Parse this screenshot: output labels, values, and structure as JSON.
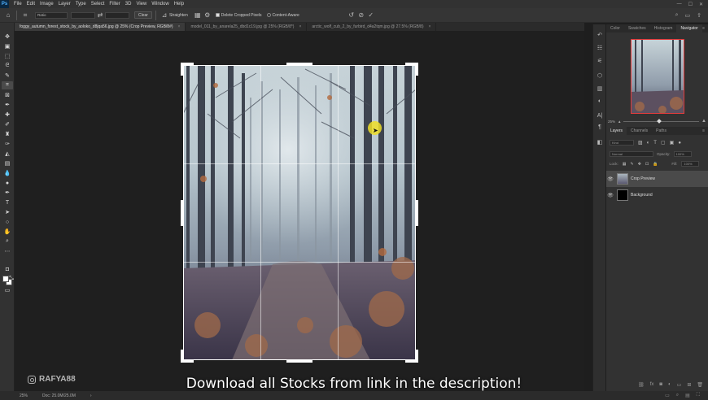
{
  "app": {
    "logo": "Ps"
  },
  "menu": [
    "File",
    "Edit",
    "Image",
    "Layer",
    "Type",
    "Select",
    "Filter",
    "3D",
    "View",
    "Window",
    "Help"
  ],
  "window_controls": [
    "—",
    "☐",
    "✕"
  ],
  "options_bar": {
    "ratio_label": "Ratio",
    "clear_label": "Clear",
    "straighten_label": "Straighten",
    "delete_cropped_label": "Delete Cropped Pixels",
    "content_aware_label": "Content-Aware"
  },
  "tabs": [
    {
      "label": "foggy_autumn_forest_stock_by_aoloko_d8jqa56.jpg @ 25% (Crop Preview, RGB/8#)",
      "active": true
    },
    {
      "label": "model_011_by_anarela25_dbd1c19.jpg @ 25% (RGB/8*)",
      "active": false
    },
    {
      "label": "arctic_wolf_cub_2_by_furbird_d4a2tqm.jpg @ 27.5% (RGB/8)",
      "active": false
    }
  ],
  "tools": [
    "move-tool-icon",
    "artboard-icon",
    "marquee-tool-icon",
    "lasso-tool-icon",
    "quick-select-icon",
    "crop-tool-icon",
    "frame-tool-icon",
    "eyedropper-icon",
    "healing-brush-icon",
    "brush-tool-icon",
    "clone-stamp-icon",
    "history-brush-icon",
    "eraser-icon",
    "gradient-tool-icon",
    "blur-tool-icon",
    "dodge-tool-icon",
    "pen-tool-icon",
    "type-tool-icon",
    "path-select-icon",
    "rectangle-tool-icon",
    "hand-tool-icon",
    "zoom-tool-icon",
    "more-tools-icon"
  ],
  "caption": "Download all Stocks from link in the description!",
  "watermark": "RAFYA88",
  "status": {
    "zoom": "25%",
    "doc": "Doc: 25.0M/25.0M"
  },
  "right_panel": {
    "top_tabs": [
      "Color",
      "Swatches",
      "Histogram",
      "Navigator"
    ],
    "zoom_value": "25%",
    "layer_tabs": [
      "Layers",
      "Channels",
      "Paths"
    ],
    "kind_label": "Kind",
    "blend_mode": "Normal",
    "opacity_label": "Opacity:",
    "opacity_value": "100%",
    "lock_label": "Lock:",
    "fill_label": "Fill:",
    "fill_value": "100%",
    "layers": [
      {
        "name": "Crop Preview",
        "selected": true
      },
      {
        "name": "Background",
        "selected": false
      }
    ]
  },
  "colors": {
    "accent": "#e23b3b",
    "cursor": "#eede28"
  }
}
